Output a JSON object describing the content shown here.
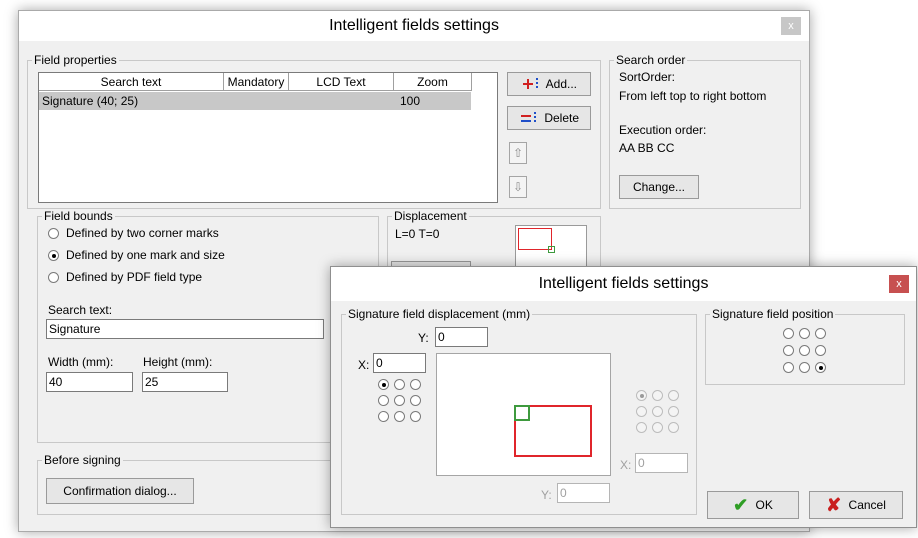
{
  "main_dialog": {
    "title": "Intelligent fields settings",
    "close_label": "x",
    "field_properties": {
      "legend": "Field properties",
      "columns": [
        "Search text",
        "Mandatory",
        "LCD Text",
        "Zoom"
      ],
      "rows": [
        {
          "search_text": "Signature (40; 25)",
          "mandatory": "",
          "lcd_text": "",
          "zoom": "100"
        }
      ],
      "add_label": "Add...",
      "delete_label": "Delete",
      "up_glyph": "⇧",
      "down_glyph": "⇩"
    },
    "search_order": {
      "legend": "Search order",
      "sort_label": "SortOrder:",
      "sort_value": "From left top to right bottom",
      "exec_label": "Execution order:",
      "exec_value": "AA BB CC",
      "change_label": "Change..."
    },
    "field_bounds": {
      "legend": "Field bounds",
      "options": [
        "Defined by two corner marks",
        "Defined by one mark and size",
        "Defined by PDF field type"
      ],
      "selected_index": 1,
      "search_text_label": "Search text:",
      "search_text_value": "Signature",
      "width_label": "Width (mm):",
      "width_value": "40",
      "height_label": "Height (mm):",
      "height_value": "25"
    },
    "displacement": {
      "legend": "Displacement",
      "value": "L=0 T=0"
    },
    "before_signing": {
      "legend": "Before signing",
      "confirmation_label": "Confirmation dialog..."
    }
  },
  "sub_dialog": {
    "title": "Intelligent fields settings",
    "close_label": "x",
    "displacement": {
      "legend": "Signature field displacement (mm)",
      "y_label": "Y:",
      "y_value": "0",
      "x_label": "X:",
      "x_value": "0",
      "x2_label": "X:",
      "x2_value": "0",
      "y2_label": "Y:",
      "y2_value": "0",
      "left_radio_selected": 0,
      "right_radio_selected": 0
    },
    "position": {
      "legend": "Signature field position",
      "selected": 8
    },
    "ok_label": "OK",
    "cancel_label": "Cancel"
  },
  "colors": {
    "close_red": "#c75050",
    "close_gray": "#c7c7c7",
    "preview_red": "#e0252b",
    "preview_green": "#3e9a3e",
    "ok_check": "#2f9e25",
    "cancel_x": "#c9201f",
    "add_icon_red": "#d12020",
    "delete_icon_blue": "#1f4fc9"
  },
  "icons": {
    "add": "add-field-icon",
    "delete": "delete-field-icon",
    "ok": "checkmark-icon",
    "cancel": "cross-icon"
  }
}
